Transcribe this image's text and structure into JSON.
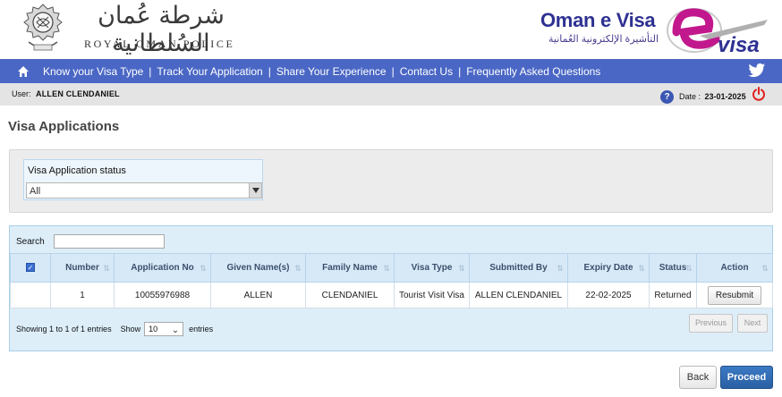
{
  "header": {
    "rop_arabic": "شرطة عُمان السُلطانية",
    "rop_english": "ROYAL OMAN POLICE",
    "evisa_title": "Oman e Visa",
    "evisa_arabic": "التأشيرة الإلكترونية العُمانية",
    "evisa_logo_text": "visa",
    "brand_color": "#2e3192",
    "accent_color": "#c2188d"
  },
  "nav": {
    "home_icon": "home-icon",
    "items": [
      "Know your Visa Type",
      "Track Your Application",
      "Share Your Experience",
      "Contact Us",
      "Frequently Asked Questions"
    ],
    "separator": "|",
    "social_icon": "twitter-icon",
    "bar_color": "#4a67c5"
  },
  "userbar": {
    "user_label": "User:",
    "user_name": "ALLEN  CLENDANIEL",
    "help_icon": "?",
    "date_label": "Date :",
    "date_value": "23-01-2025",
    "logout_icon": "power-icon"
  },
  "page": {
    "title": "Visa Applications"
  },
  "filter": {
    "label": "Visa Application status",
    "selected": "All"
  },
  "table": {
    "search_label": "Search",
    "search_value": "",
    "columns": [
      "",
      "Number",
      "Application No",
      "Given Name(s)",
      "Family Name",
      "Visa Type",
      "Submitted By",
      "Expiry Date",
      "Status",
      "Action"
    ],
    "rows": [
      {
        "number": "1",
        "application_no": "10055976988",
        "given_names": "ALLEN",
        "family_name": "CLENDANIEL",
        "visa_type": "Tourist Visit Visa",
        "submitted_by": "ALLEN CLENDANIEL",
        "expiry_date": "22-02-2025",
        "status": "Returned",
        "action_label": "Resubmit"
      }
    ],
    "info": "Showing 1 to 1 of 1 entries",
    "show_label": "Show",
    "page_length": "10",
    "entries_label": "entries",
    "prev_label": "Previous",
    "next_label": "Next"
  },
  "actions": {
    "back_label": "Back",
    "proceed_label": "Proceed"
  }
}
